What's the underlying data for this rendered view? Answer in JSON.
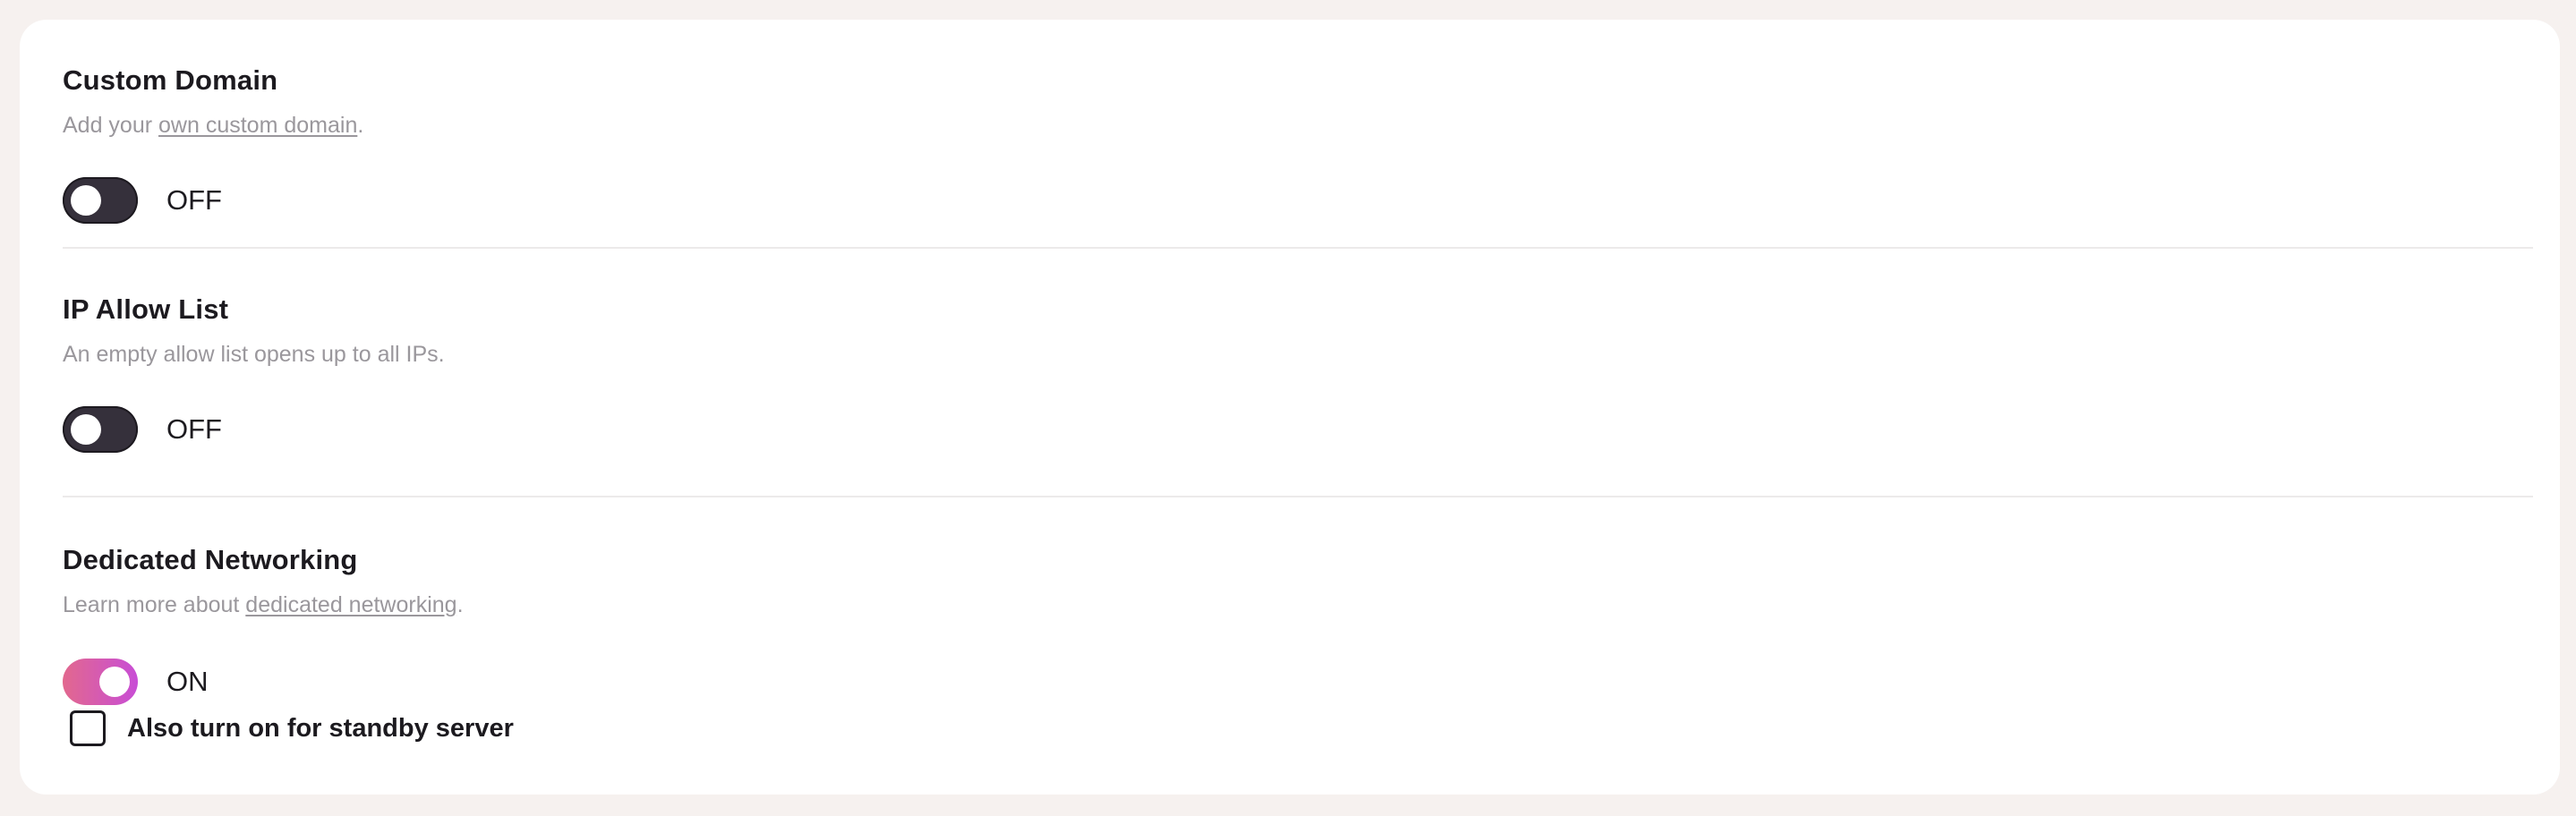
{
  "sections": [
    {
      "title": "Custom Domain",
      "description_prefix": "Add your ",
      "description_link": "own custom domain",
      "description_suffix": ".",
      "toggle": {
        "state": "off",
        "label": "OFF"
      }
    },
    {
      "title": "IP Allow List",
      "description": "An empty allow list opens up to all IPs.",
      "toggle": {
        "state": "off",
        "label": "OFF"
      }
    },
    {
      "title": "Dedicated Networking",
      "description_prefix": "Learn more about ",
      "description_link": "dedicated networking",
      "description_suffix": ".",
      "toggle": {
        "state": "on",
        "label": "ON"
      },
      "checkbox": {
        "label": "Also turn on for standby server",
        "checked": false
      }
    }
  ],
  "colors": {
    "page_background": "#f6f1ef",
    "card_background": "#ffffff",
    "toggle_off": "#35303b",
    "toggle_on_start": "#e2688e",
    "toggle_on_end": "#c84dd6",
    "muted_text": "#9a979c"
  }
}
